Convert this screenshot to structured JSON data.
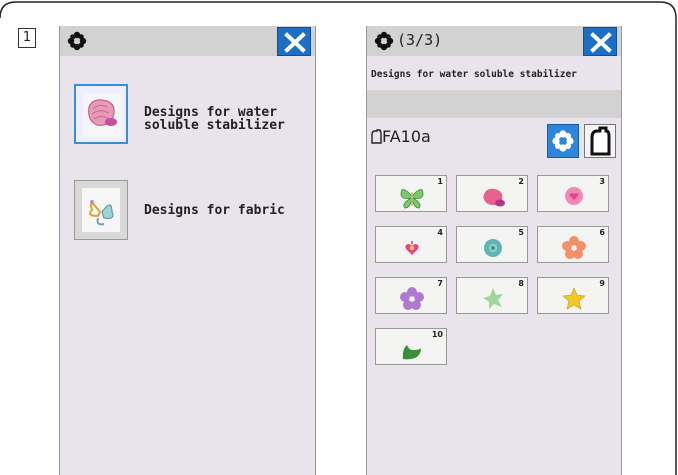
{
  "step_number": "1",
  "screen1": {
    "menu": [
      {
        "label": "Designs for water\nsoluble stabilizer",
        "selected": true
      },
      {
        "label": "Designs for fabric",
        "selected": false
      }
    ]
  },
  "screen2": {
    "page_indicator": "(3/3)",
    "subtitle": "Designs for water soluble stabilizer",
    "hoop_code": "FA10a",
    "designs": [
      {
        "num": "1",
        "shape": "butterfly",
        "color": "#7cc870"
      },
      {
        "num": "2",
        "shape": "shell",
        "color": "#e7628f"
      },
      {
        "num": "3",
        "shape": "heart-flower",
        "color": "#f08ab8"
      },
      {
        "num": "4",
        "shape": "small-heart",
        "color": "#e8468a"
      },
      {
        "num": "5",
        "shape": "round-flower",
        "color": "#5cb8b0"
      },
      {
        "num": "6",
        "shape": "flower",
        "color": "#f3906a"
      },
      {
        "num": "7",
        "shape": "flower",
        "color": "#b07ad0"
      },
      {
        "num": "8",
        "shape": "star-flower",
        "color": "#9bd89a"
      },
      {
        "num": "9",
        "shape": "star",
        "color": "#f2c826"
      },
      {
        "num": "10",
        "shape": "leaf",
        "color": "#3c8f3a"
      }
    ]
  },
  "colors": {
    "accent": "#1c6fc4",
    "screen_bg": "#e9e3ec",
    "titlebar_bg": "#d2d2d2"
  }
}
